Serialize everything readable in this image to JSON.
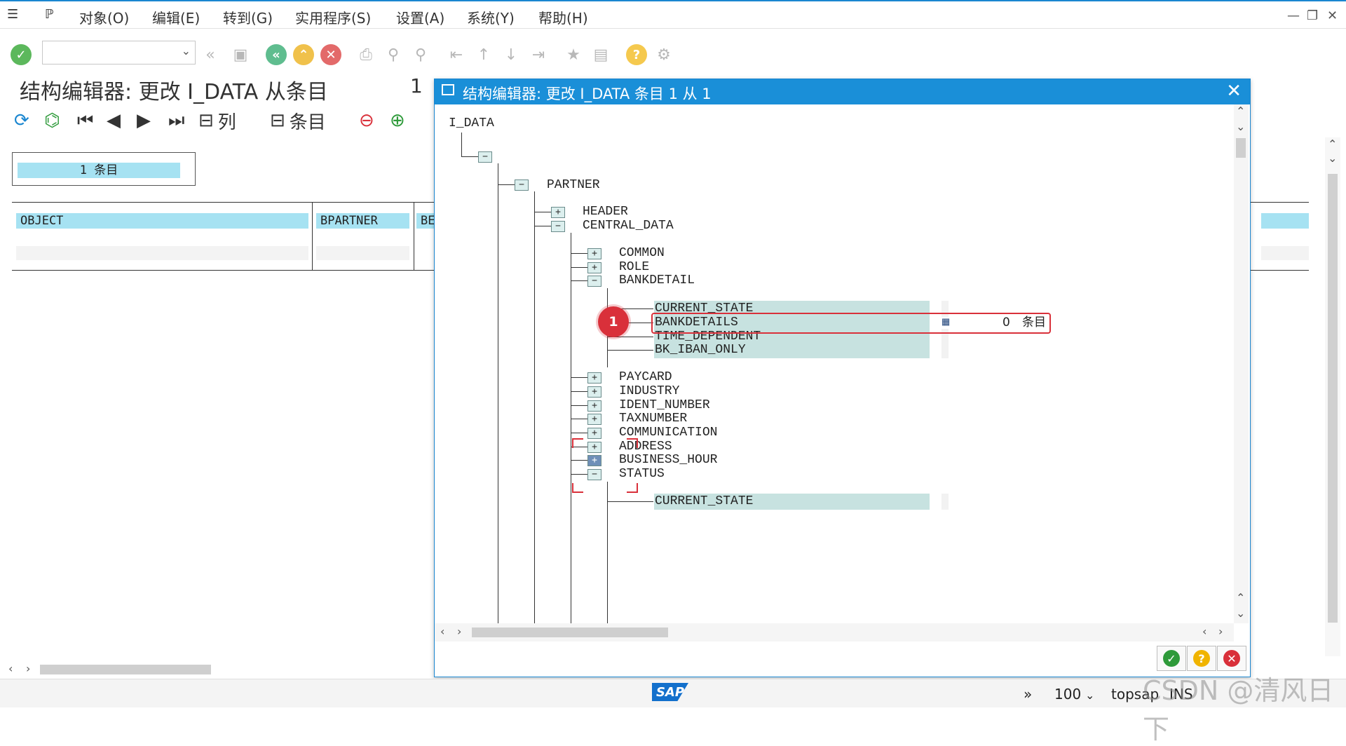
{
  "menu": {
    "items": [
      "对象(O)",
      "编辑(E)",
      "转到(G)",
      "实用程序(S)",
      "设置(A)",
      "系统(Y)",
      "帮助(H)"
    ]
  },
  "window_controls": {
    "minimize": "—",
    "restore": "❐",
    "close": "✕"
  },
  "page": {
    "title": "结构编辑器: 更改 I_DATA 从条目",
    "number": "1"
  },
  "app_toolbar": {
    "columns_label": "列",
    "entries_label": "条目"
  },
  "entry_count": "1 条目",
  "table": {
    "headers": [
      "OBJECT",
      "BPARTNER",
      "BE"
    ]
  },
  "dialog": {
    "title": "结构编辑器: 更改 I_DATA 条目 1 从 1",
    "close": "✕",
    "tree": {
      "root": "I_DATA",
      "partner": "PARTNER",
      "header": "HEADER",
      "central_data": "CENTRAL_DATA",
      "common": "COMMON",
      "role": "ROLE",
      "bankdetail": "BANKDETAIL",
      "current_state": "CURRENT_STATE",
      "bankdetails": "BANKDETAILS",
      "bankdetails_count": "0",
      "bankdetails_unit": "条目",
      "time_dependent": "TIME_DEPENDENT",
      "bk_iban_only": "BK_IBAN_ONLY",
      "paycard": "PAYCARD",
      "industry": "INDUSTRY",
      "ident_number": "IDENT_NUMBER",
      "taxnumber": "TAXNUMBER",
      "communication": "COMMUNICATION",
      "address": "ADDRESS",
      "business_hour": "BUSINESS_HOUR",
      "status": "STATUS",
      "status_current_state": "CURRENT_STATE"
    },
    "annotation_badge": "1"
  },
  "status_bar": {
    "zoom": "100",
    "system": "topsap",
    "mode": "INS",
    "logo": "SAP",
    "watermark": "CSDN @清风日下"
  },
  "colors": {
    "accent": "#1a8fd8",
    "header_cell": "#a6e2f2",
    "leaf_bg": "#c7e2e0",
    "annotation": "#d9303a"
  }
}
